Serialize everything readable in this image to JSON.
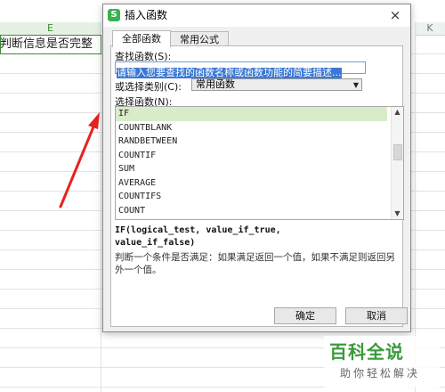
{
  "sheet": {
    "column_e": "E",
    "column_k": "K",
    "cell_text": "判断信息是否完整"
  },
  "dialog": {
    "icon_letter": "S",
    "title": "插入函数",
    "close": "×",
    "tabs": [
      {
        "label": "全部函数",
        "active": true
      },
      {
        "label": "常用公式",
        "active": false
      }
    ],
    "search_label": "查找函数(S):",
    "search_value": "请输入您要查找的函数名称或函数功能的简要描述...",
    "category_label": "或选择类别(C):",
    "category_value": "常用函数",
    "function_label": "选择函数(N):",
    "functions": [
      "IF",
      "COUNTBLANK",
      "RANDBETWEEN",
      "COUNTIF",
      "SUM",
      "AVERAGE",
      "COUNTIFS",
      "COUNT"
    ],
    "selected_function": "IF",
    "signature_line1": "IF(logical_test, value_if_true,",
    "signature_line2": "value_if_false)",
    "description": "判断一个条件是否满足：如果满足返回一个值，如果不满足则返回另外一个值。",
    "ok_label": "确定",
    "cancel_label": "取消"
  },
  "watermark": {
    "main": "百科全说",
    "sub": "助你轻松解决"
  },
  "colors": {
    "accent_green": "#3a9a3a",
    "selection_green": "#d9ecc9",
    "arrow_red": "#e8231f",
    "input_highlight": "#3a78d5"
  }
}
